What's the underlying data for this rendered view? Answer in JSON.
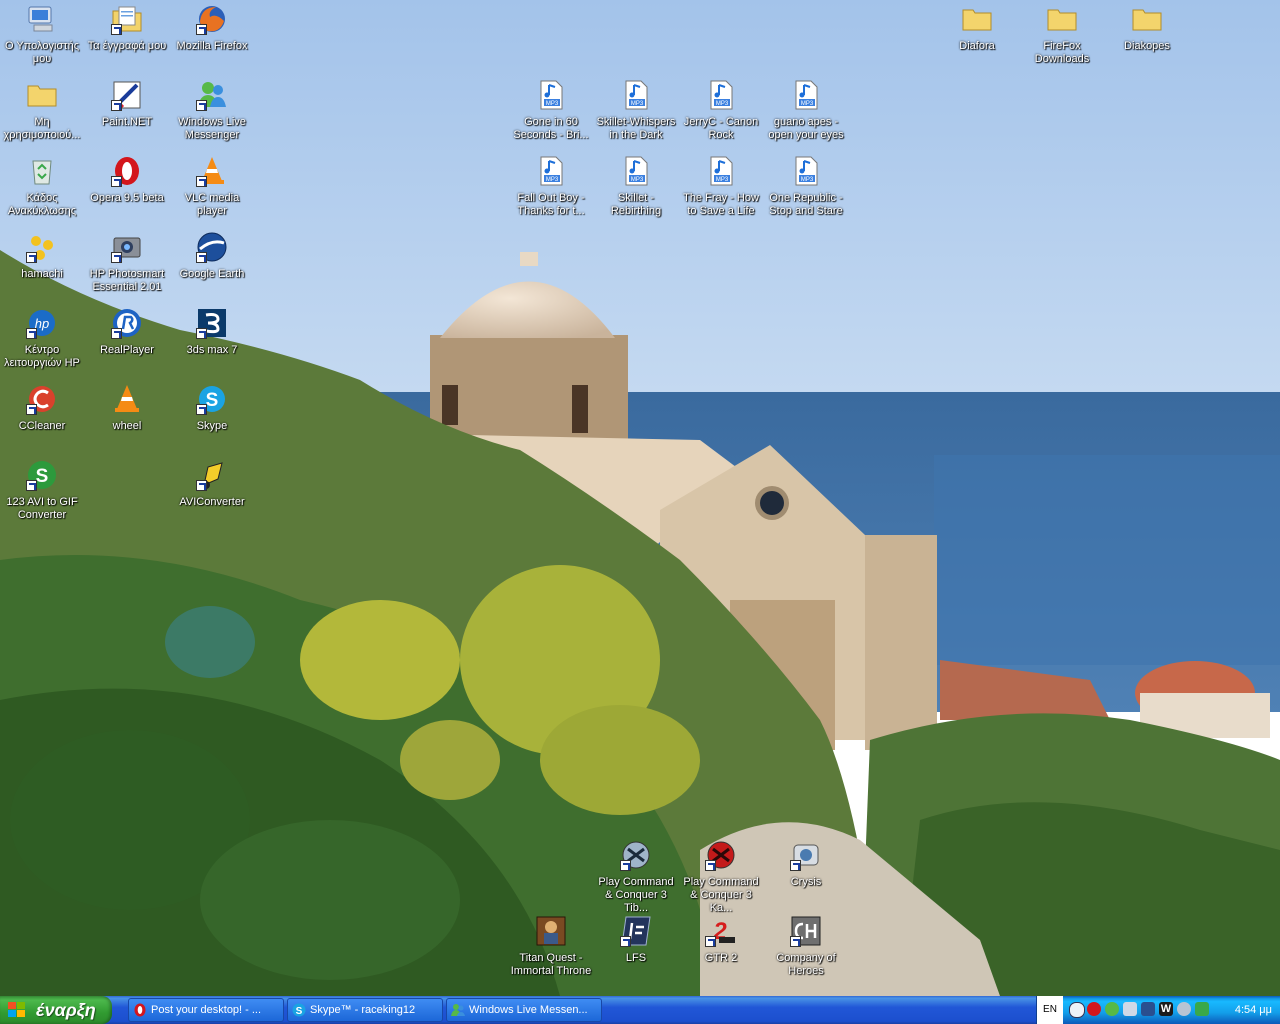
{
  "desktop": {
    "icons": [
      {
        "id": "my-computer",
        "label": "Ο Υπολογιστής μου",
        "icon": "my-computer-icon",
        "shortcut": false
      },
      {
        "id": "my-documents",
        "label": "Τα έγγραφά μου",
        "icon": "my-documents-icon",
        "shortcut": true
      },
      {
        "id": "firefox",
        "label": "Mozilla Firefox",
        "icon": "firefox-icon",
        "shortcut": true
      },
      {
        "id": "unused",
        "label": "Μη χρησιμοποιού...",
        "icon": "folder-icon",
        "shortcut": false
      },
      {
        "id": "paintnet",
        "label": "Paint.NET",
        "icon": "paintnet-icon",
        "shortcut": true
      },
      {
        "id": "wlm",
        "label": "Windows Live Messenger",
        "icon": "messenger-icon",
        "shortcut": true
      },
      {
        "id": "recycle",
        "label": "Κάδος Ανακύκλωσης",
        "icon": "recycle-bin-icon",
        "shortcut": false
      },
      {
        "id": "opera",
        "label": "Opera 9.5 beta",
        "icon": "opera-icon",
        "shortcut": true
      },
      {
        "id": "vlc",
        "label": "VLC media player",
        "icon": "vlc-icon",
        "shortcut": true
      },
      {
        "id": "hamachi",
        "label": "hamachi",
        "icon": "hamachi-icon",
        "shortcut": true
      },
      {
        "id": "hpphoto",
        "label": "HP Photosmart Essential 2.01",
        "icon": "hp-photosmart-icon",
        "shortcut": true
      },
      {
        "id": "gearth",
        "label": "Google Earth",
        "icon": "google-earth-icon",
        "shortcut": true
      },
      {
        "id": "hpcenter",
        "label": "Κέντρο λειτουργιών HP",
        "icon": "hp-icon",
        "shortcut": true
      },
      {
        "id": "realplayer",
        "label": "RealPlayer",
        "icon": "realplayer-icon",
        "shortcut": true
      },
      {
        "id": "3dsmax",
        "label": "3ds max 7",
        "icon": "3ds-max-icon",
        "shortcut": true
      },
      {
        "id": "ccleaner",
        "label": "CCleaner",
        "icon": "ccleaner-icon",
        "shortcut": true
      },
      {
        "id": "wheel",
        "label": "wheel",
        "icon": "vlc-icon",
        "shortcut": false
      },
      {
        "id": "skype",
        "label": "Skype",
        "icon": "skype-icon",
        "shortcut": true
      },
      {
        "id": "123avi",
        "label": "123 AVI to GIF Converter",
        "icon": "avi-gif-icon",
        "shortcut": true
      },
      {
        "id": "aviconv",
        "label": "AVIConverter",
        "icon": "avi-converter-icon",
        "shortcut": true
      },
      {
        "id": "mp3-gone",
        "label": "Gone in 60 Seconds - Bri...",
        "icon": "mp3-icon",
        "shortcut": false
      },
      {
        "id": "mp3-whispers",
        "label": "Skillet-Whispers in the Dark",
        "icon": "mp3-icon",
        "shortcut": false
      },
      {
        "id": "mp3-canon",
        "label": "JerryC - Canon Rock",
        "icon": "mp3-icon",
        "shortcut": false
      },
      {
        "id": "mp3-guano",
        "label": "guano apes - open your eyes",
        "icon": "mp3-icon",
        "shortcut": false
      },
      {
        "id": "mp3-fob",
        "label": "Fall Out Boy - Thanks for t...",
        "icon": "mp3-icon",
        "shortcut": false
      },
      {
        "id": "mp3-rebirthing",
        "label": "Skillet - Rebirthing",
        "icon": "mp3-icon",
        "shortcut": false
      },
      {
        "id": "mp3-fray",
        "label": "The Fray - How to Save a Life",
        "icon": "mp3-icon",
        "shortcut": false
      },
      {
        "id": "mp3-onerep",
        "label": "One Republic - Stop and Stare",
        "icon": "mp3-icon",
        "shortcut": false
      },
      {
        "id": "diafora",
        "label": "Diafora",
        "icon": "folder-icon",
        "shortcut": false
      },
      {
        "id": "ffdl",
        "label": "FireFox Downloads",
        "icon": "folder-icon",
        "shortcut": false
      },
      {
        "id": "diakopes",
        "label": "Diakopes",
        "icon": "folder-icon",
        "shortcut": false
      },
      {
        "id": "cnc3tib",
        "label": "Play Command & Conquer 3 Tib...",
        "icon": "cnc3-icon",
        "shortcut": true
      },
      {
        "id": "cnc3ka",
        "label": "Play Command & Conquer 3 Ka...",
        "icon": "cnc3-kane-icon",
        "shortcut": true
      },
      {
        "id": "crysis",
        "label": "Crysis",
        "icon": "crysis-icon",
        "shortcut": true
      },
      {
        "id": "titanquest",
        "label": "Titan Quest - Immortal Throne",
        "icon": "titan-quest-icon",
        "shortcut": false
      },
      {
        "id": "lfs",
        "label": "LFS",
        "icon": "lfs-icon",
        "shortcut": true
      },
      {
        "id": "gtr2",
        "label": "GTR 2",
        "icon": "gtr2-icon",
        "shortcut": true
      },
      {
        "id": "coh",
        "label": "Company of Heroes",
        "icon": "company-of-heroes-icon",
        "shortcut": true
      }
    ]
  },
  "taskbar": {
    "start_label": "έναρξη",
    "tasks": [
      {
        "label": "Post your desktop! - ...",
        "icon": "opera-icon"
      },
      {
        "label": "Skype™ - raceking12",
        "icon": "skype-icon"
      },
      {
        "label": "Windows Live Messen...",
        "icon": "messenger-icon"
      }
    ],
    "tray": {
      "language": "EN",
      "icons": [
        "back-arrow-icon",
        "opera-tray-icon",
        "messenger-tray-icon",
        "antivirus-icon",
        "network-icon",
        "winamp-icon",
        "volume-icon",
        "kaspersky-icon"
      ],
      "clock": "4:54 μμ"
    }
  },
  "colors": {
    "taskbar": "#245edb",
    "start": "#3c9a3c",
    "tray": "#139ee9"
  }
}
